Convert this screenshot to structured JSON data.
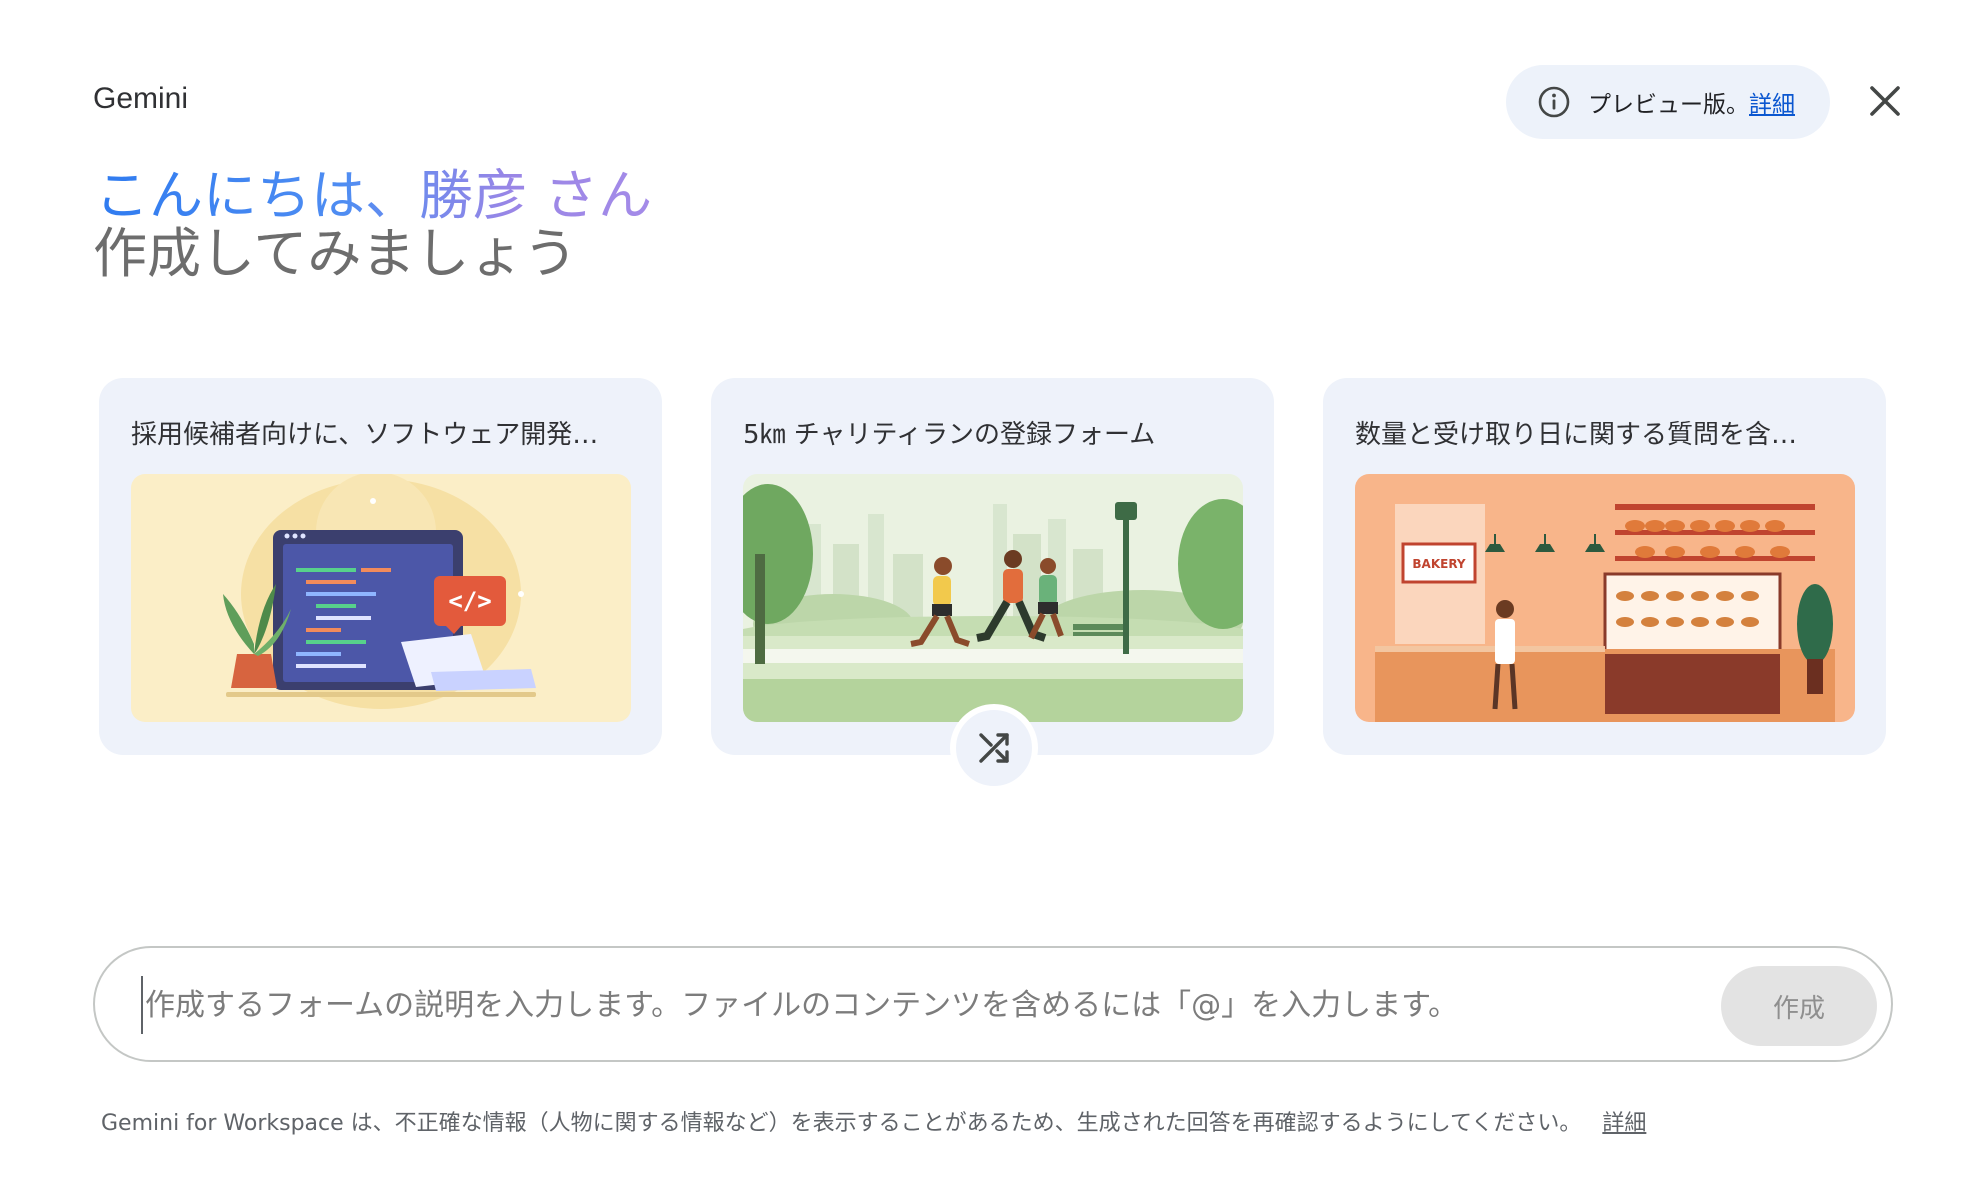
{
  "app": {
    "title": "Gemini"
  },
  "preview": {
    "text": "プレビュー版。",
    "link": "詳細"
  },
  "greeting": {
    "hello": "こんにちは、勝彦 さん",
    "subtitle": "作成してみましょう"
  },
  "suggestions": [
    {
      "title": "採用候補者向けに、ソフトウェア開発…",
      "image": "developer-laptop-illustration"
    },
    {
      "title": "5㎞ チャリティランの登録フォーム",
      "image": "park-runners-illustration"
    },
    {
      "title": "数量と受け取り日に関する質問を含…",
      "image": "bakery-illustration"
    }
  ],
  "bakery_sign": "BAKERY",
  "code_tag": "</>",
  "prompt": {
    "placeholder": "作成するフォームの説明を入力します。ファイルのコンテンツを含めるには「@」を入力します。",
    "value": "",
    "submit_label": "作成"
  },
  "footer": {
    "disclaimer": "Gemini for Workspace は、不正確な情報（人物に関する情報など）を表示することがあるため、生成された回答を再確認するようにしてください。",
    "link": "詳細"
  },
  "icons": {
    "info": "info-icon",
    "close": "close-icon",
    "shuffle": "shuffle-icon"
  },
  "colors": {
    "accent": "#0b57d0",
    "card_bg": "#eef2fa",
    "greeting_start": "#2f7bf0",
    "greeting_end": "#a48be8"
  }
}
